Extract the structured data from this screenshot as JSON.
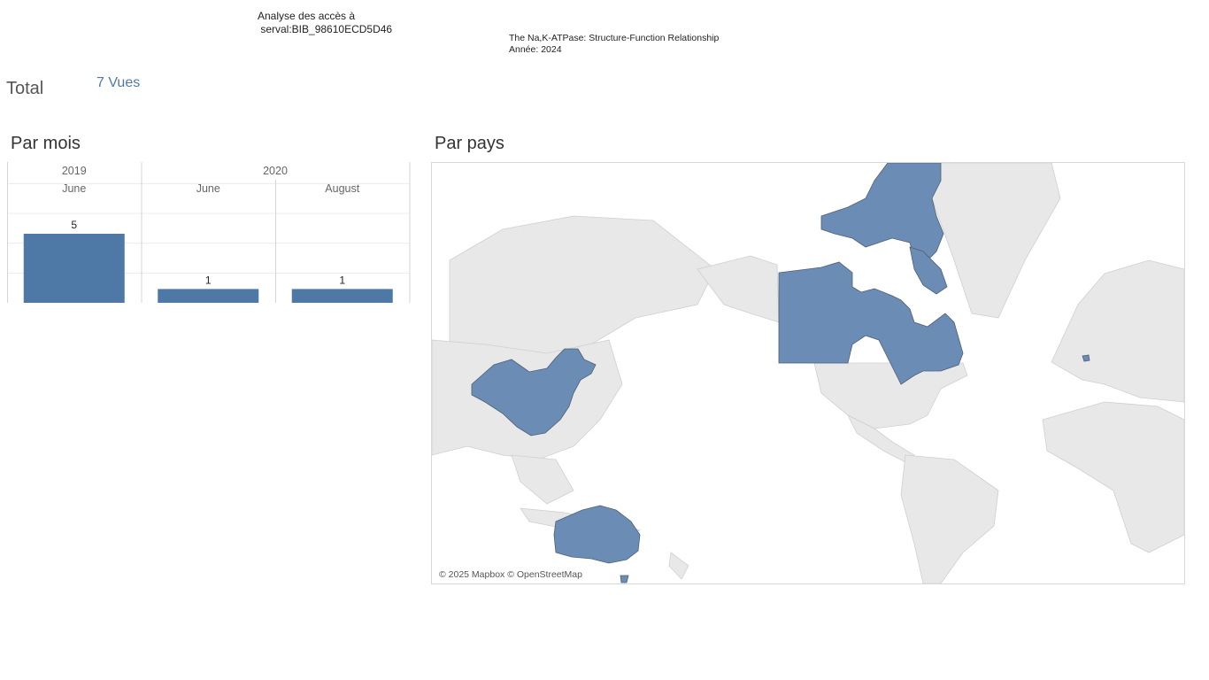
{
  "header": {
    "analysis_title": "Analyse des accès à\n serval:BIB_98610ECD5D46",
    "publication_title": "The Na,K-ATPase: Structure-Function Relationship",
    "publication_year": "Année: 2024"
  },
  "total": {
    "label": "Total",
    "value": "7 Vues"
  },
  "sections": {
    "by_month": "Par mois",
    "by_country": "Par pays"
  },
  "chart_data": [
    {
      "type": "bar",
      "title": "Par mois",
      "groups": [
        {
          "year": "2019",
          "months": [
            "June"
          ]
        },
        {
          "year": "2020",
          "months": [
            "June",
            "August"
          ]
        }
      ],
      "categories": [
        "June",
        "June",
        "August"
      ],
      "values": [
        5,
        1,
        1
      ],
      "ylim": [
        0,
        5
      ],
      "grid": true,
      "color": "#4e79a7"
    },
    {
      "type": "map",
      "title": "Par pays",
      "highlighted_countries": [
        "Canada",
        "China",
        "Australia",
        "Belgium"
      ],
      "highlight_color": "#6b8db5",
      "base_color": "#e8e8e8",
      "credit": "© 2025 Mapbox © OpenStreetMap"
    }
  ]
}
